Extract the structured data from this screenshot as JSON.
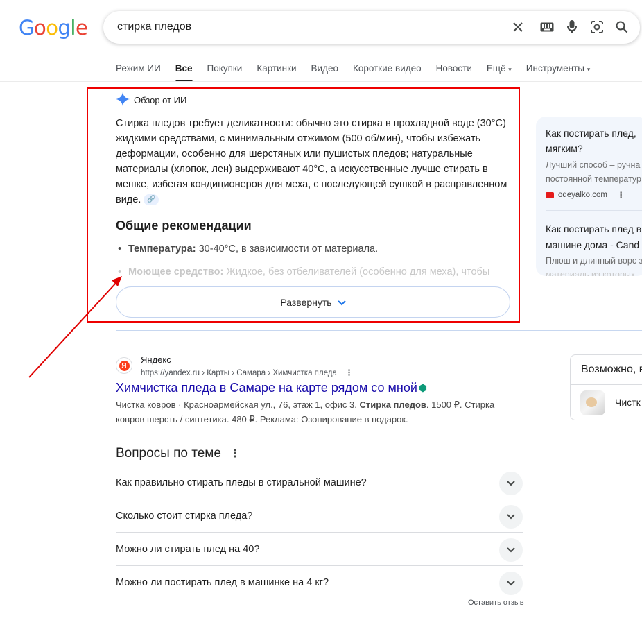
{
  "search": {
    "logo": "Google",
    "query": "стирка пледов"
  },
  "tabs": [
    "Режим ИИ",
    "Все",
    "Покупки",
    "Картинки",
    "Видео",
    "Короткие видео",
    "Новости",
    "Ещё",
    "Инструменты"
  ],
  "active_tab": "Все",
  "ai_overview": {
    "label": "Обзор от ИИ",
    "text": "Стирка пледов требует деликатности: обычно это стирка в прохладной воде (30°C) жидкими средствами, с минимальным отжимом (500 об/мин), чтобы избежать деформации, особенно для шерстяных или пушистых пледов; натуральные материалы (хлопок, лен) выдерживают 40°C, а искусственные лучше стирать в мешке, избегая кондиционеров для меха, с последующей сушкой в расправленном виде.",
    "heading": "Общие рекомендации",
    "items": [
      {
        "bold": "Температура:",
        "text": " 30-40°C, в зависимости от материала."
      },
      {
        "bold": "Моющее средство:",
        "text": " Жидкое, без отбеливателей (особенно для меха), чтобы"
      }
    ],
    "expand_label": "Развернуть"
  },
  "side_card": {
    "item1_title_line1": "Как постирать плед,",
    "item1_title_line2": "мягким?",
    "item1_snippet_line1": "Лучший способ – ручна",
    "item1_snippet_line2": "постоянной температур",
    "item1_source": "odeyalko.com",
    "item2_title_line1": "Как постирать плед в",
    "item2_title_line2": "машине дома - Cand",
    "item2_snippet_line1": "Плюш и длинный ворс з",
    "item2_snippet_line2": "материаль из которых"
  },
  "result": {
    "site_name": "Яндекс",
    "url": "https://yandex.ru › Карты › Самара › Химчистка пледа",
    "title": "Химчистка пледа в Самаре на карте рядом со мной",
    "snippet_pre": "Чистка ковров · Красноармейская ул., 76, этаж 1, офис 3. ",
    "snippet_bold": "Стирка пледов",
    "snippet_post": ". 1500 ₽. Стирка ковров шерсть / синтетика. 480 ₽. Реклама: Озонирование в подарок."
  },
  "maybe": {
    "title": "Возможно, в",
    "item": "Чистк"
  },
  "paa": {
    "heading": "Вопросы по теме",
    "questions": [
      "Как правильно стирать пледы в стиральной машине?",
      "Сколько стоит стирка пледа?",
      "Можно ли стирать плед на 40?",
      "Можно ли постирать плед в машинке на 4 кг?"
    ],
    "feedback": "Оставить отзыв"
  },
  "colors": {
    "annotation": "#e00000",
    "link": "#1a0dab"
  }
}
